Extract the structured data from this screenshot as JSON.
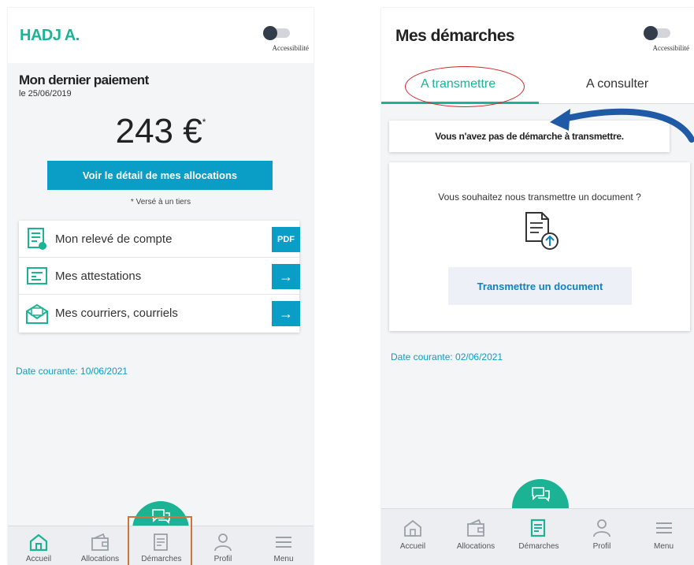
{
  "left": {
    "header": {
      "user_name": "HADJ A.",
      "accessibility_label": "Accessibilité"
    },
    "payment": {
      "title": "Mon dernier paiement",
      "date": "le 25/06/2019",
      "amount": "243 €",
      "amount_mark": "*",
      "details_button": "Voir le détail de mes allocations",
      "note": "* Versé à un tiers"
    },
    "links": [
      {
        "label": "Mon relevé de compte",
        "icon": "account-statement-icon",
        "action": "PDF"
      },
      {
        "label": "Mes attestations",
        "icon": "certificate-icon",
        "action": "→"
      },
      {
        "label": "Mes courriers, courriels",
        "icon": "mail-icon",
        "action": "→"
      }
    ],
    "current_date": "Date courante: 10/06/2021",
    "nav": [
      {
        "label": "Accueil",
        "icon": "home-icon"
      },
      {
        "label": "Allocations",
        "icon": "wallet-icon"
      },
      {
        "label": "Démarches",
        "icon": "form-icon"
      },
      {
        "label": "Profil",
        "icon": "user-icon"
      },
      {
        "label": "Menu",
        "icon": "menu-icon"
      }
    ]
  },
  "right": {
    "header": {
      "title": "Mes démarches",
      "accessibility_label": "Accessibilité"
    },
    "tabs": {
      "active": "A transmettre",
      "inactive": "A consulter"
    },
    "empty_message": "Vous n'avez pas de démarche à transmettre.",
    "transmit_question": "Vous souhaitez nous transmettre un document ?",
    "transmit_button": "Transmettre un document",
    "current_date": "Date courante: 02/06/2021",
    "nav": [
      {
        "label": "Accueil",
        "icon": "home-icon"
      },
      {
        "label": "Allocations",
        "icon": "wallet-icon"
      },
      {
        "label": "Démarches",
        "icon": "form-icon"
      },
      {
        "label": "Profil",
        "icon": "user-icon"
      },
      {
        "label": "Menu",
        "icon": "menu-icon"
      }
    ]
  },
  "colors": {
    "brand_green": "#1bb394",
    "brand_blue": "#0a9ec6",
    "annotation_red": "#d4262a",
    "annotation_orange": "#d0743c",
    "annotation_arrow": "#1f5aa6"
  }
}
